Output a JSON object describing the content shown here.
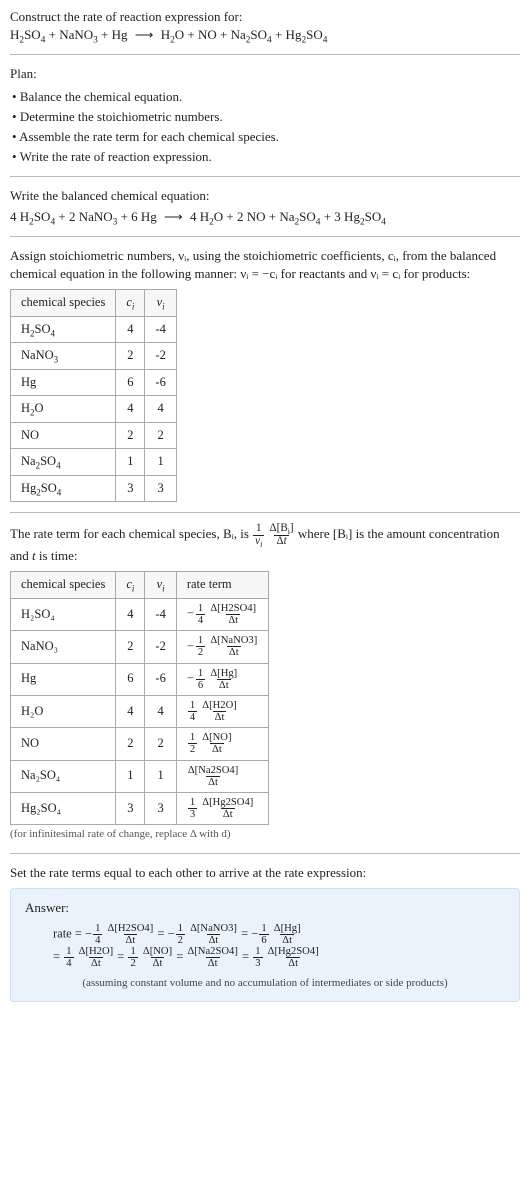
{
  "header": {
    "prompt": "Construct the rate of reaction expression for:",
    "reaction_lhs": "H₂SO₄ + NaNO₃ + Hg",
    "reaction_rhs": "H₂O + NO + Na₂SO₄ + Hg₂SO₄"
  },
  "plan": {
    "title": "Plan:",
    "items": [
      "Balance the chemical equation.",
      "Determine the stoichiometric numbers.",
      "Assemble the rate term for each chemical species.",
      "Write the rate of reaction expression."
    ]
  },
  "balanced": {
    "title": "Write the balanced chemical equation:",
    "lhs": "4 H₂SO₄ + 2 NaNO₃ + 6 Hg",
    "rhs": "4 H₂O + 2 NO + Na₂SO₄ + 3 Hg₂SO₄"
  },
  "stoich_intro": "Assign stoichiometric numbers, νᵢ, using the stoichiometric coefficients, cᵢ, from the balanced chemical equation in the following manner: νᵢ = −cᵢ for reactants and νᵢ = cᵢ for products:",
  "table1": {
    "headers": [
      "chemical species",
      "cᵢ",
      "νᵢ"
    ],
    "rows": [
      {
        "sp": "H₂SO₄",
        "c": "4",
        "v": "-4"
      },
      {
        "sp": "NaNO₃",
        "c": "2",
        "v": "-2"
      },
      {
        "sp": "Hg",
        "c": "6",
        "v": "-6"
      },
      {
        "sp": "H₂O",
        "c": "4",
        "v": "4"
      },
      {
        "sp": "NO",
        "c": "2",
        "v": "2"
      },
      {
        "sp": "Na₂SO₄",
        "c": "1",
        "v": "1"
      },
      {
        "sp": "Hg₂SO₄",
        "c": "3",
        "v": "3"
      }
    ]
  },
  "rate_intro_a": "The rate term for each chemical species, Bᵢ, is ",
  "rate_intro_b": " where [Bᵢ] is the amount concentration and ",
  "rate_intro_c": " is time:",
  "t_var": "t",
  "table2": {
    "headers": [
      "chemical species",
      "cᵢ",
      "νᵢ",
      "rate term"
    ],
    "rows": [
      {
        "sp": "H₂SO₄",
        "c": "4",
        "v": "-4",
        "sign": "-",
        "coef_num": "1",
        "coef_den": "4",
        "conc": "Δ[H2SO4]"
      },
      {
        "sp": "NaNO₃",
        "c": "2",
        "v": "-2",
        "sign": "-",
        "coef_num": "1",
        "coef_den": "2",
        "conc": "Δ[NaNO3]"
      },
      {
        "sp": "Hg",
        "c": "6",
        "v": "-6",
        "sign": "-",
        "coef_num": "1",
        "coef_den": "6",
        "conc": "Δ[Hg]"
      },
      {
        "sp": "H₂O",
        "c": "4",
        "v": "4",
        "sign": "",
        "coef_num": "1",
        "coef_den": "4",
        "conc": "Δ[H2O]"
      },
      {
        "sp": "NO",
        "c": "2",
        "v": "2",
        "sign": "",
        "coef_num": "1",
        "coef_den": "2",
        "conc": "Δ[NO]"
      },
      {
        "sp": "Na₂SO₄",
        "c": "1",
        "v": "1",
        "sign": "",
        "coef_num": "",
        "coef_den": "",
        "conc": "Δ[Na2SO4]"
      },
      {
        "sp": "Hg₂SO₄",
        "c": "3",
        "v": "3",
        "sign": "",
        "coef_num": "1",
        "coef_den": "3",
        "conc": "Δ[Hg2SO4]"
      }
    ]
  },
  "dt": "Δt",
  "footnote": "(for infinitesimal rate of change, replace Δ with d)",
  "set_equal": "Set the rate terms equal to each other to arrive at the rate expression:",
  "answer": {
    "label": "Answer:",
    "rate_word": "rate",
    "eq": "=",
    "terms": [
      {
        "sign": "-",
        "num": "1",
        "den": "4",
        "conc": "Δ[H2SO4]"
      },
      {
        "sign": "-",
        "num": "1",
        "den": "2",
        "conc": "Δ[NaNO3]"
      },
      {
        "sign": "-",
        "num": "1",
        "den": "6",
        "conc": "Δ[Hg]"
      },
      {
        "sign": "",
        "num": "1",
        "den": "4",
        "conc": "Δ[H2O]"
      },
      {
        "sign": "",
        "num": "1",
        "den": "2",
        "conc": "Δ[NO]"
      },
      {
        "sign": "",
        "num": "",
        "den": "",
        "conc": "Δ[Na2SO4]"
      },
      {
        "sign": "",
        "num": "1",
        "den": "3",
        "conc": "Δ[Hg2SO4]"
      }
    ],
    "assume": "(assuming constant volume and no accumulation of intermediates or side products)"
  },
  "chart_data": {
    "type": "table",
    "title": "Stoichiometric numbers and rate terms",
    "tables": [
      {
        "columns": [
          "chemical species",
          "c_i",
          "nu_i"
        ],
        "rows": [
          [
            "H2SO4",
            4,
            -4
          ],
          [
            "NaNO3",
            2,
            -2
          ],
          [
            "Hg",
            6,
            -6
          ],
          [
            "H2O",
            4,
            4
          ],
          [
            "NO",
            2,
            2
          ],
          [
            "Na2SO4",
            1,
            1
          ],
          [
            "Hg2SO4",
            3,
            3
          ]
        ]
      },
      {
        "columns": [
          "chemical species",
          "c_i",
          "nu_i",
          "rate term"
        ],
        "rows": [
          [
            "H2SO4",
            4,
            -4,
            "-(1/4) d[H2SO4]/dt"
          ],
          [
            "NaNO3",
            2,
            -2,
            "-(1/2) d[NaNO3]/dt"
          ],
          [
            "Hg",
            6,
            -6,
            "-(1/6) d[Hg]/dt"
          ],
          [
            "H2O",
            4,
            4,
            "(1/4) d[H2O]/dt"
          ],
          [
            "NO",
            2,
            2,
            "(1/2) d[NO]/dt"
          ],
          [
            "Na2SO4",
            1,
            1,
            "d[Na2SO4]/dt"
          ],
          [
            "Hg2SO4",
            3,
            3,
            "(1/3) d[Hg2SO4]/dt"
          ]
        ]
      }
    ]
  }
}
